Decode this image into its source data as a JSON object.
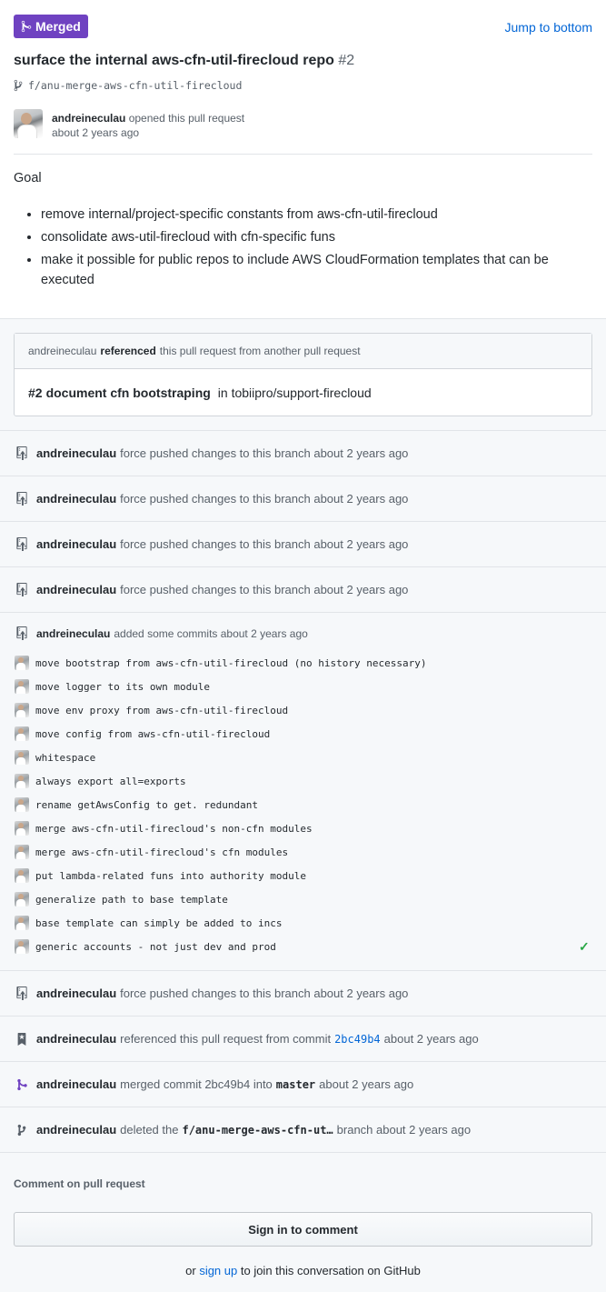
{
  "header": {
    "badge_label": "Merged",
    "jump_label": "Jump to bottom",
    "title": "surface the internal aws-cfn-util-firecloud repo",
    "number": "#2",
    "branch": "f/anu-merge-aws-cfn-util-firecloud",
    "author": "andreineculau",
    "opened_text": "opened this pull request",
    "opened_time": "about 2 years ago"
  },
  "body": {
    "goal": "Goal",
    "bullets": [
      "remove internal/project-specific constants from aws-cfn-util-firecloud",
      "consolidate aws-util-firecloud with cfn-specific funs",
      "make it possible for public repos to include AWS CloudFormation templates that can be executed"
    ]
  },
  "reference": {
    "user": "andreineculau",
    "verb": "referenced",
    "rest": "this pull request from another pull request",
    "pr_number": "#2",
    "pr_title": "document cfn bootstraping",
    "pr_in": "in tobiipro/support-firecloud"
  },
  "force_push": {
    "user": "andreineculau",
    "text": "force pushed changes to this branch about 2 years ago"
  },
  "commits_block": {
    "user": "andreineculau",
    "text": "added some commits about 2 years ago",
    "commits": [
      "move bootstrap from aws-cfn-util-firecloud (no history necessary)",
      "move logger to its own module",
      "move env proxy from aws-cfn-util-firecloud",
      "move config from aws-cfn-util-firecloud",
      "whitespace",
      "always export all=exports",
      "rename getAwsConfig to get. redundant",
      "merge aws-cfn-util-firecloud's non-cfn modules",
      "merge aws-cfn-util-firecloud's cfn modules",
      "put lambda-related funs into authority module",
      "generalize path to base template",
      "base template can simply be added to incs",
      "generic accounts - not just dev and prod"
    ],
    "check": "✓"
  },
  "events": {
    "ref_commit": {
      "user": "andreineculau",
      "text": "referenced this pull request from commit",
      "sha": "2bc49b4",
      "time": "about 2 years ago"
    },
    "merged": {
      "user": "andreineculau",
      "text": "merged commit 2bc49b4 into",
      "target": "master",
      "time": "about 2 years ago"
    },
    "deleted": {
      "user": "andreineculau",
      "text": "deleted the",
      "branch": "f/anu-merge-aws-cfn-ut…",
      "rest": "branch about 2 years ago"
    }
  },
  "comment": {
    "label": "Comment on pull request",
    "signin": "Sign in to comment",
    "or": "or",
    "signup": "sign up",
    "rest": "to join this conversation on GitHub"
  }
}
